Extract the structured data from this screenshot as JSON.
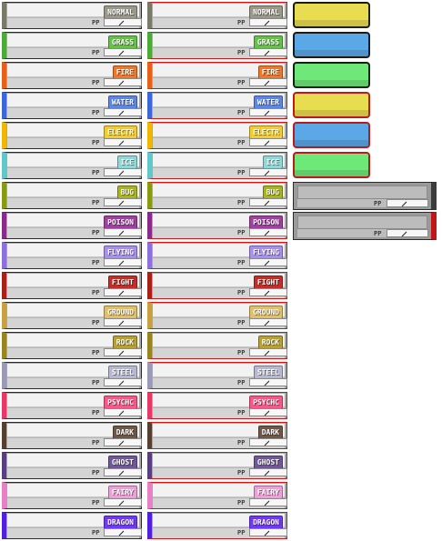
{
  "pp_label": "PP",
  "types": [
    {
      "label": "NORMAL",
      "badge": "#9a9888",
      "stripe": "#7b7a6a"
    },
    {
      "label": "GRASS",
      "badge": "#66c04a",
      "stripe": "#4eaa38"
    },
    {
      "label": "FIRE",
      "badge": "#f07828",
      "stripe": "#e86018"
    },
    {
      "label": "WATER",
      "badge": "#5e86e6",
      "stripe": "#3c68d8"
    },
    {
      "label": "ELECTR",
      "badge": "#f4cc30",
      "stripe": "#f0b800"
    },
    {
      "label": "ICE",
      "badge": "#8ed8d8",
      "stripe": "#60c8c8"
    },
    {
      "label": "BUG",
      "badge": "#a8b420",
      "stripe": "#8a9a10"
    },
    {
      "label": "POISON",
      "badge": "#a040a0",
      "stripe": "#8a2a8a"
    },
    {
      "label": "FLYING",
      "badge": "#a890f0",
      "stripe": "#8c70e0"
    },
    {
      "label": "FIGHT",
      "badge": "#c03028",
      "stripe": "#a82018"
    },
    {
      "label": "GROUND",
      "badge": "#e0c068",
      "stripe": "#c8a040"
    },
    {
      "label": "ROCK",
      "badge": "#b8a038",
      "stripe": "#9a8420"
    },
    {
      "label": "STEEL",
      "badge": "#b8b8d0",
      "stripe": "#9a9ab8"
    },
    {
      "label": "PSYCHC",
      "badge": "#f85888",
      "stripe": "#e83868"
    },
    {
      "label": "DARK",
      "badge": "#705848",
      "stripe": "#584030"
    },
    {
      "label": "GHOST",
      "badge": "#705898",
      "stripe": "#584080"
    },
    {
      "label": "FAIRY",
      "badge": "#f0a0d8",
      "stripe": "#e880c8"
    },
    {
      "label": "DRAGON",
      "badge": "#7038f8",
      "stripe": "#5020e0"
    }
  ],
  "right_column_frame_color": "#c81818",
  "swatches": [
    {
      "fill": "#e8dc50",
      "border": "#1a1a1a"
    },
    {
      "fill": "#5aa8e6",
      "border": "#1a1a1a"
    },
    {
      "fill": "#6ee878",
      "border": "#1a1a1a"
    },
    {
      "fill": "#e8dc50",
      "border": "#c01818"
    },
    {
      "fill": "#5aa8e6",
      "border": "#c01818"
    },
    {
      "fill": "#6ee878",
      "border": "#c01818"
    }
  ],
  "empty_slots": [
    {
      "frame": "dark"
    },
    {
      "frame": "red"
    }
  ]
}
